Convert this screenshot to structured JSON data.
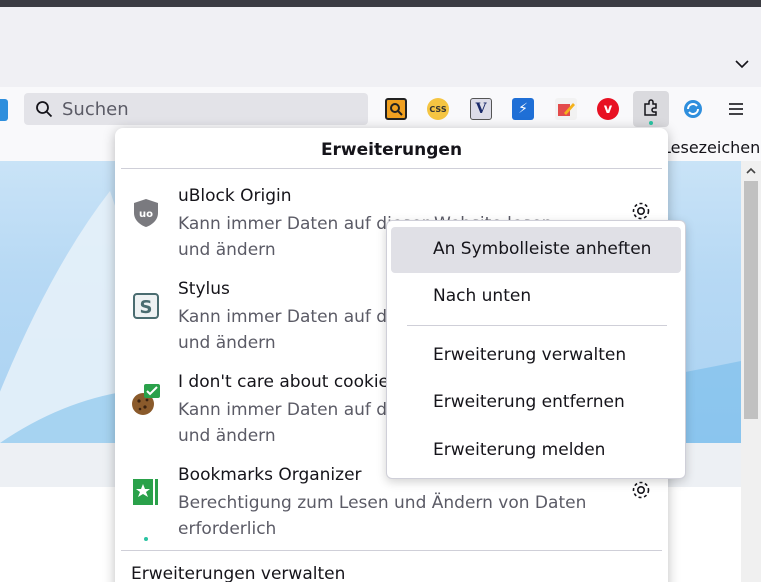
{
  "toolbar": {
    "search_placeholder": "Suchen",
    "icons": [
      "css-viewer-icon",
      "color-picker-icon",
      "vimium-icon",
      "bolt-icon",
      "edit-icon",
      "vivaldi-icon",
      "extensions-puzzle-icon",
      "sync-icon",
      "menu-icon"
    ]
  },
  "bookmarks": {
    "label": "Lesezeichen"
  },
  "panel": {
    "title": "Erweiterungen",
    "extensions": [
      {
        "name": "uBlock Origin",
        "desc": "Kann immer Daten auf dieser Website lesen und ändern"
      },
      {
        "name": "Stylus",
        "desc": "Kann immer Daten auf dieser Website lesen und ändern"
      },
      {
        "name": "I don't care about cookies",
        "desc": "Kann immer Daten auf dieser Website lesen und ändern"
      },
      {
        "name": "Bookmarks Organizer",
        "desc": "Berechtigung zum Lesen und Ändern von Daten erforderlich"
      }
    ],
    "manage": "Erweiterungen verwalten"
  },
  "context_menu": {
    "items": [
      "An Symbolleiste anheften",
      "Nach unten",
      "Erweiterung verwalten",
      "Erweiterung entfernen",
      "Erweiterung melden"
    ]
  },
  "colors": {
    "accent": "#2ac3a2",
    "highlight": "#e0e0e6"
  }
}
